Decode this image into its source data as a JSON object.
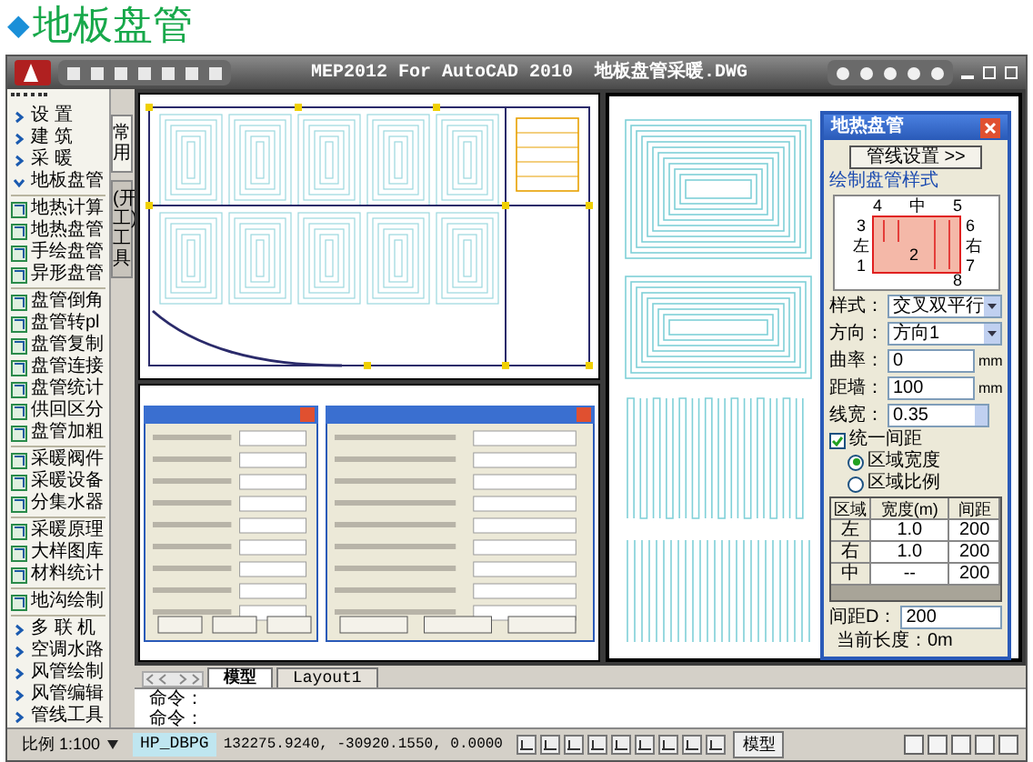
{
  "page_title": {
    "marker": "◆",
    "text": "地板盘管"
  },
  "window": {
    "title": "MEP2012 For AutoCAD 2010  地板盘管采暖.DWG"
  },
  "side_menu": {
    "sections": [
      {
        "items": [
          {
            "label": "设 置",
            "kind": "group",
            "expanded": false
          },
          {
            "label": "建 筑",
            "kind": "group",
            "expanded": false
          },
          {
            "label": "采 暖",
            "kind": "group",
            "expanded": false
          },
          {
            "label": "地板盘管",
            "kind": "group",
            "expanded": true
          }
        ]
      },
      {
        "items": [
          {
            "label": "地热计算",
            "kind": "tool"
          },
          {
            "label": "地热盘管",
            "kind": "tool"
          },
          {
            "label": "手绘盘管",
            "kind": "tool"
          },
          {
            "label": "异形盘管",
            "kind": "tool"
          }
        ]
      },
      {
        "items": [
          {
            "label": "盘管倒角",
            "kind": "tool"
          },
          {
            "label": "盘管转pl",
            "kind": "tool"
          },
          {
            "label": "盘管复制",
            "kind": "tool"
          },
          {
            "label": "盘管连接",
            "kind": "tool"
          },
          {
            "label": "盘管统计",
            "kind": "tool"
          },
          {
            "label": "供回区分",
            "kind": "tool"
          },
          {
            "label": "盘管加粗",
            "kind": "tool"
          }
        ]
      },
      {
        "items": [
          {
            "label": "采暖阀件",
            "kind": "tool"
          },
          {
            "label": "采暖设备",
            "kind": "tool"
          },
          {
            "label": "分集水器",
            "kind": "tool"
          }
        ]
      },
      {
        "items": [
          {
            "label": "采暖原理",
            "kind": "tool"
          },
          {
            "label": "大样图库",
            "kind": "tool"
          },
          {
            "label": "材料统计",
            "kind": "tool"
          }
        ]
      },
      {
        "items": [
          {
            "label": "地沟绘制",
            "kind": "tool"
          }
        ]
      },
      {
        "items": [
          {
            "label": "多 联 机",
            "kind": "group",
            "expanded": false
          },
          {
            "label": "空调水路",
            "kind": "group",
            "expanded": false
          },
          {
            "label": "风管绘制",
            "kind": "group",
            "expanded": false
          },
          {
            "label": "风管编辑",
            "kind": "group",
            "expanded": false
          },
          {
            "label": "管线工具",
            "kind": "group",
            "expanded": false
          }
        ]
      }
    ]
  },
  "side_tabs": [
    {
      "label": "常用",
      "selected": true
    },
    {
      "label": "(开工)工具",
      "selected": false
    }
  ],
  "coil_dialog": {
    "title": "地热盘管",
    "settings_button": "管线设置 >>",
    "style_group": "绘制盘管样式",
    "diagram_labels": [
      "4",
      "中",
      "5",
      "3",
      "6",
      "左",
      "右",
      "2",
      "1",
      "7",
      "8"
    ],
    "fields": [
      {
        "label": "样式：",
        "value": "交叉双平行",
        "kind": "select"
      },
      {
        "label": "方向：",
        "value": "方向1",
        "kind": "select"
      },
      {
        "label": "曲率：",
        "value": "0",
        "unit": "mm",
        "kind": "text"
      },
      {
        "label": "距墙：",
        "value": "100",
        "unit": "mm",
        "kind": "text"
      },
      {
        "label": "线宽：",
        "value": "0.35",
        "kind": "spin"
      }
    ],
    "uniform_spacing": {
      "label": "统一间距",
      "checked": true
    },
    "radios": [
      {
        "label": "区域宽度",
        "selected": true
      },
      {
        "label": "区域比例",
        "selected": false
      }
    ],
    "table": {
      "columns": [
        "区域",
        "宽度(m)",
        "间距"
      ],
      "rows": [
        [
          "左",
          "1.0",
          "200"
        ],
        [
          "右",
          "1.0",
          "200"
        ],
        [
          "中",
          "--",
          "200"
        ]
      ]
    },
    "spacing": {
      "label": "间距D：",
      "value": "200"
    },
    "length": "当前长度：0m"
  },
  "layout_tabs": [
    {
      "label": "模型",
      "selected": true
    },
    {
      "label": "Layout1",
      "selected": false
    }
  ],
  "command_lines": [
    "命令：",
    "命令："
  ],
  "status_bar": {
    "scale": "比例 1:100",
    "layer": "HP_DBPG",
    "coordinates": "132275.9240, -30920.1550, 0.0000",
    "model": "模型"
  }
}
